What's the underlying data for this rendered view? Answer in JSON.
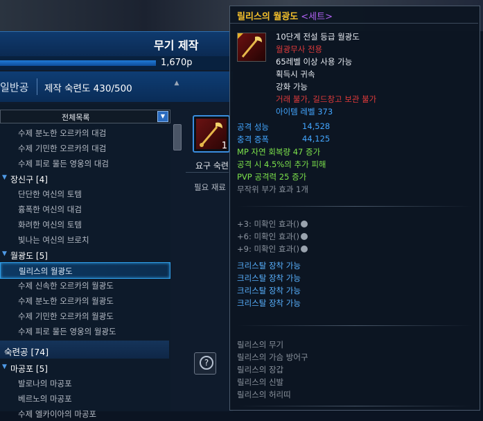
{
  "window": {
    "title": "무기 제작"
  },
  "points": {
    "value": "1,670p",
    "fill": 0.67
  },
  "skill": {
    "category": "일반공",
    "label": "제작 숙련도 430/500"
  },
  "list": {
    "filter": "전체목록",
    "items": [
      {
        "type": "item",
        "label": "수제 분노한 오르카의 대검"
      },
      {
        "type": "item",
        "label": "수제 기민한 오르카의 대검"
      },
      {
        "type": "item",
        "label": "수제 피로 물든 영웅의 대검"
      },
      {
        "type": "cat",
        "label": "장신구 [4]"
      },
      {
        "type": "item",
        "label": "단단한 여신의 토템"
      },
      {
        "type": "item",
        "label": "흉폭한 여신의 대검"
      },
      {
        "type": "item",
        "label": "화려한 여신의 토템"
      },
      {
        "type": "item",
        "label": "빛나는 여신의 브로치"
      },
      {
        "type": "cat",
        "label": "월광도 [5]"
      },
      {
        "type": "item",
        "label": "릴리스의 월광도",
        "selected": true
      },
      {
        "type": "item",
        "label": "수제 신속한 오르카의 월광도"
      },
      {
        "type": "item",
        "label": "수제 분노한 오르카의 월광도"
      },
      {
        "type": "item",
        "label": "수제 기민한 오르카의 월광도"
      },
      {
        "type": "item",
        "label": "수제 피로 물든 영웅의 월광도"
      }
    ],
    "section": "숙련공 [74]",
    "items2": [
      {
        "type": "cat",
        "label": "마공포 [5]"
      },
      {
        "type": "item",
        "label": "발로나의 마공포"
      },
      {
        "type": "item",
        "label": "베르노의 마공포"
      },
      {
        "type": "item",
        "label": "수제 엘카이아의 마공포"
      }
    ]
  },
  "detail": {
    "count": "1",
    "req_label": "요구 숙련",
    "mat_label": "필요 재료"
  },
  "tooltip": {
    "title": "릴리스의 월광도",
    "set_tag": "<세트>",
    "lines_top": [
      {
        "text": "10단계 전설 등급 월광도",
        "cls": "w"
      },
      {
        "text": "월광무사 전용",
        "cls": "r"
      },
      {
        "text": "65레벨 이상 사용 가능",
        "cls": "w"
      },
      {
        "text": "획득시 귀속",
        "cls": "w"
      },
      {
        "text": "강화 가능",
        "cls": "w"
      },
      {
        "text": "거래 불가, 길드창고 보관 불가",
        "cls": "r"
      },
      {
        "text": "아이템 레벨 373",
        "cls": "b"
      }
    ],
    "stats": [
      {
        "name": "공격 성능",
        "value": "14,528"
      },
      {
        "name": "충격 증폭",
        "value": "44,125"
      }
    ],
    "bonus": [
      {
        "text": "MP 자연 회복량 47 증가",
        "cls": "g"
      },
      {
        "text": "공격 시 4.5%의 추가 피해",
        "cls": "g"
      },
      {
        "text": "PVP 공격력 25 증가",
        "cls": "g"
      },
      {
        "text": "무작위 부가 효과 1개",
        "cls": "gr"
      }
    ],
    "enchant": [
      "+3: 미확인 효과()",
      "+6: 미확인 효과()",
      "+9: 미확인 효과()"
    ],
    "crystals": [
      "크리스탈 장착 가능",
      "크리스탈 장착 가능",
      "크리스탈 장착 가능",
      "크리스탈 장착 가능"
    ],
    "set_items": [
      "릴리스의 무기",
      "릴리스의 가슴 방어구",
      "릴리스의 장갑",
      "릴리스의 신발",
      "릴리스의 허리띠"
    ]
  },
  "colors": {
    "title": "#f4c02c",
    "set": "#b061f2",
    "red": "#e03a3a",
    "blue": "#43a6ff",
    "green": "#7ce24b"
  }
}
